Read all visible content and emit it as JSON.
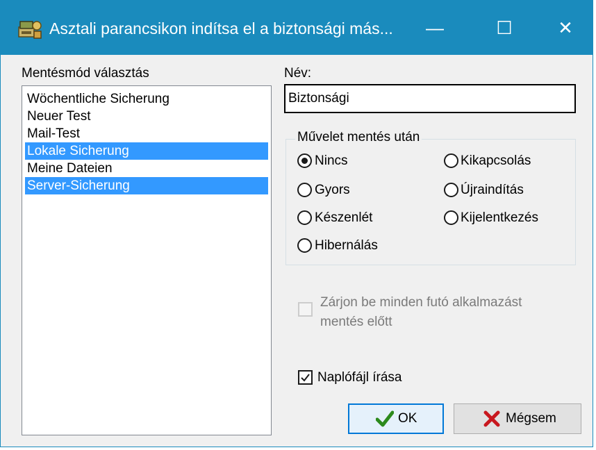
{
  "window": {
    "title": "Asztali parancsikon indítsa el a biztonsági más...",
    "controls": {
      "minimize": "—",
      "maximize": "☐",
      "close": "✕"
    },
    "accent_color": "#1a8bbd"
  },
  "backup_list": {
    "label": "Mentésmód választás",
    "items": [
      {
        "label": "Wöchentliche Sicherung",
        "selected": false
      },
      {
        "label": "Neuer Test",
        "selected": false
      },
      {
        "label": "Mail-Test",
        "selected": false
      },
      {
        "label": "Lokale Sicherung",
        "selected": true
      },
      {
        "label": "Meine Dateien",
        "selected": false
      },
      {
        "label": "Server-Sicherung",
        "selected": true
      }
    ]
  },
  "name_field": {
    "label": "Név:",
    "value": "Biztonsági"
  },
  "after_backup": {
    "title": "Művelet mentés után",
    "options": [
      {
        "label": "Nincs",
        "checked": true
      },
      {
        "label": "Gyors",
        "checked": false
      },
      {
        "label": "Készenlét",
        "checked": false
      },
      {
        "label": "Hibernálás",
        "checked": false
      },
      {
        "label": "Kikapcsolás",
        "checked": false
      },
      {
        "label": "Újraindítás",
        "checked": false
      },
      {
        "label": "Kijelentkezés",
        "checked": false
      }
    ]
  },
  "close_apps": {
    "line1": "Zárjon be minden futó alkalmazást",
    "line2": "mentés előtt",
    "checked": false,
    "enabled": false
  },
  "write_log": {
    "label": "Naplófájl írása",
    "checked": true
  },
  "buttons": {
    "ok": "OK",
    "cancel": "Mégsem"
  },
  "icons": {
    "app": "backup-app-icon",
    "ok": "checkmark-icon",
    "cancel": "red-x-icon"
  }
}
